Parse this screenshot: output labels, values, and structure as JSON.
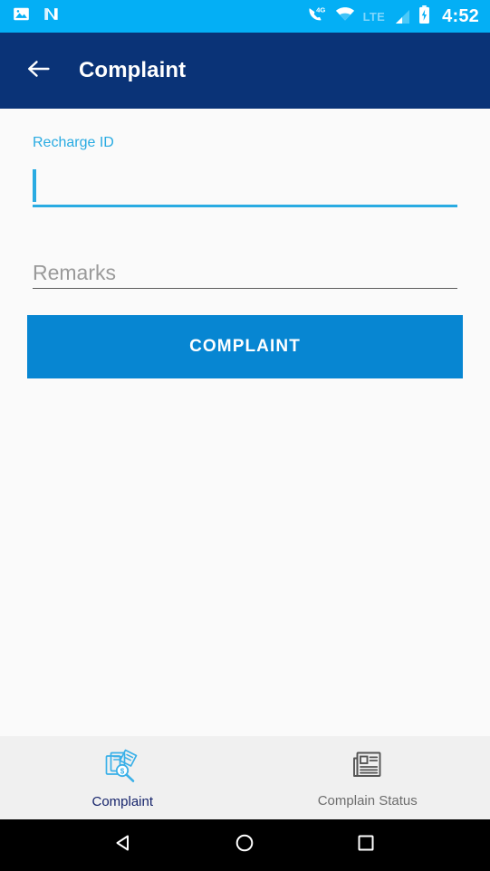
{
  "status_bar": {
    "background": "#04aff5",
    "clock": "4:52",
    "network_label": "4G",
    "lte_label": "LTE",
    "icons": [
      "image-icon",
      "android-n-icon",
      "call-4g-icon",
      "wifi-icon",
      "signal-icon",
      "battery-charging-icon"
    ]
  },
  "app_bar": {
    "background": "#0a3377",
    "title": "Complaint",
    "back_icon": "arrow-left-icon"
  },
  "form": {
    "recharge_id": {
      "label": "Recharge ID",
      "value": "",
      "placeholder": "",
      "accent": "#29abe2",
      "focused": true
    },
    "remarks": {
      "label": "Remarks",
      "value": "",
      "placeholder": "Remarks",
      "underline": "#5b5b5b"
    },
    "submit": {
      "label": "COMPLAINT",
      "background": "#0786d2",
      "text_color": "#ffffff"
    }
  },
  "bottom_nav": {
    "background": "#f0f0f0",
    "tabs": [
      {
        "label": "Complaint",
        "icon": "documents-search-money-icon",
        "active": true,
        "color": "#16246b"
      },
      {
        "label": "Complain Status",
        "icon": "newspaper-icon",
        "active": false,
        "color": "#6d6d6d"
      }
    ]
  },
  "system_nav": {
    "background": "#000000",
    "buttons": [
      {
        "name": "back-triangle-icon"
      },
      {
        "name": "home-circle-icon"
      },
      {
        "name": "recents-square-icon"
      }
    ]
  }
}
